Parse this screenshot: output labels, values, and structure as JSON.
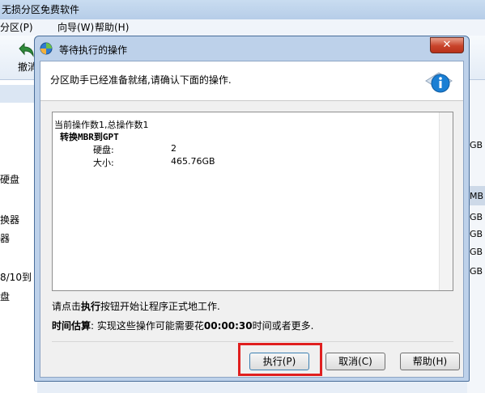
{
  "app": {
    "title": "无损分区免费软件",
    "menu": [
      "分区(P)",
      "向导(W)",
      "帮助(H)"
    ],
    "toolbar": {
      "undo_label": "撤消"
    },
    "left_labels": [
      "硬盘",
      "换器",
      "器",
      "8/10到",
      "盘"
    ],
    "right_labels": [
      "GB",
      "MB",
      "GB",
      "GB",
      "GB",
      "GB"
    ]
  },
  "dialog": {
    "title": "等待执行的操作",
    "close_symbol": "✕",
    "header_text": "分区助手已经准备就绪,请确认下面的操作.",
    "ops": {
      "summary": "当前操作数1,总操作数1",
      "operation_title": "转换MBR到GPT",
      "rows": [
        {
          "label": "硬盘:",
          "value": "2"
        },
        {
          "label": "大小:",
          "value": "465.76GB"
        }
      ]
    },
    "note_prefix": "请点击",
    "note_bold": "执行",
    "note_suffix": "按钮开始让程序正式地工作.",
    "estimate_label": "时间估算",
    "estimate_text_before": ": 实现这些操作可能需要花",
    "estimate_time": "00:00:30",
    "estimate_text_after": "时间或者更多.",
    "buttons": {
      "execute": "执行(P)",
      "cancel": "取消(C)",
      "help": "帮助(H)"
    }
  },
  "colors": {
    "highlight": "#e01f1f",
    "close_button": "#c8432a",
    "info_icon": "#1a7fd4"
  }
}
